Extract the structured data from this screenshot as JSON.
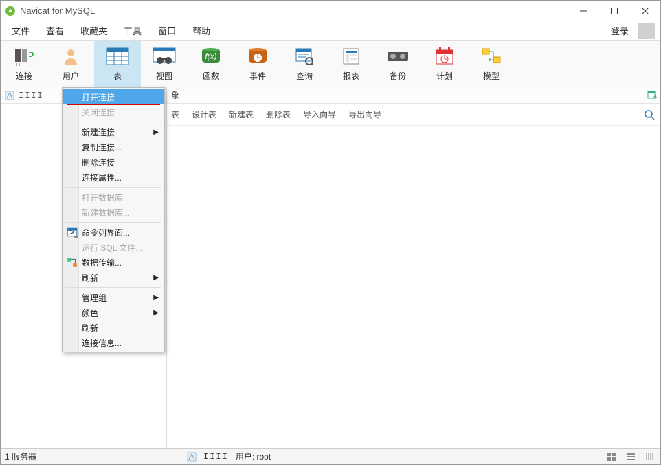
{
  "window": {
    "title": "Navicat for MySQL"
  },
  "menu": {
    "items": [
      "文件",
      "查看",
      "收藏夹",
      "工具",
      "窗口",
      "帮助"
    ],
    "login": "登录"
  },
  "toolbar": {
    "items": [
      {
        "label": "连接",
        "icon": "plug"
      },
      {
        "label": "用户",
        "icon": "user"
      },
      {
        "label": "表",
        "icon": "table",
        "active": true
      },
      {
        "label": "视图",
        "icon": "view"
      },
      {
        "label": "函数",
        "icon": "fx"
      },
      {
        "label": "事件",
        "icon": "event"
      },
      {
        "label": "查询",
        "icon": "query"
      },
      {
        "label": "报表",
        "icon": "report"
      },
      {
        "label": "备份",
        "icon": "backup"
      },
      {
        "label": "计划",
        "icon": "schedule"
      },
      {
        "label": "模型",
        "icon": "model"
      }
    ]
  },
  "sidebar": {
    "connection_name": "IIII"
  },
  "sub_tabs": {
    "obj_suffix": "象"
  },
  "body_toolbar": {
    "items": [
      {
        "label": "表",
        "icon": "open-table",
        "suffix_only": true
      },
      {
        "label": "设计表",
        "icon": "design"
      },
      {
        "label": "新建表",
        "icon": "new"
      },
      {
        "label": "删除表",
        "icon": "delete"
      },
      {
        "label": "导入向导",
        "icon": "import"
      },
      {
        "label": "导出向导",
        "icon": "export"
      }
    ]
  },
  "context_menu": {
    "items": [
      {
        "label": "打开连接",
        "kind": "item",
        "highlight": true
      },
      {
        "label": "关闭连接",
        "kind": "item",
        "disabled": true
      },
      {
        "kind": "sep"
      },
      {
        "label": "新建连接",
        "kind": "submenu"
      },
      {
        "label": "复制连接...",
        "kind": "item"
      },
      {
        "label": "删除连接",
        "kind": "item"
      },
      {
        "label": "连接属性...",
        "kind": "item"
      },
      {
        "kind": "sep"
      },
      {
        "label": "打开数据库",
        "kind": "item",
        "disabled": true
      },
      {
        "label": "新建数据库...",
        "kind": "item",
        "disabled": true
      },
      {
        "kind": "sep"
      },
      {
        "label": "命令列界面...",
        "kind": "item",
        "icon": "cli"
      },
      {
        "label": "运行 SQL 文件...",
        "kind": "item",
        "disabled": true
      },
      {
        "label": "数据传输...",
        "kind": "item",
        "icon": "transfer"
      },
      {
        "label": "刷新",
        "kind": "submenu"
      },
      {
        "kind": "sep"
      },
      {
        "label": "管理组",
        "kind": "submenu"
      },
      {
        "label": "颜色",
        "kind": "submenu"
      },
      {
        "label": "刷新",
        "kind": "item"
      },
      {
        "label": "连接信息...",
        "kind": "item"
      }
    ]
  },
  "status": {
    "left": "1 服务器",
    "conn_icon_name": "IIII",
    "user_label": "用户: root"
  },
  "colors": {
    "accent": "#4fa6e8",
    "toolbar_active": "#cce5f2"
  }
}
